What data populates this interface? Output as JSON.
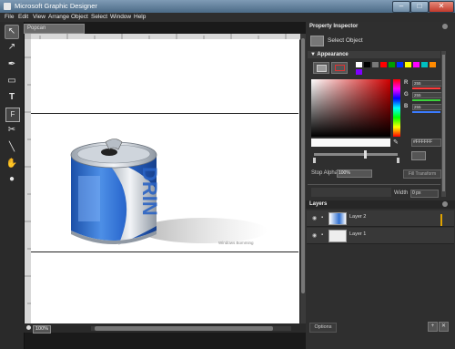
{
  "window": {
    "title": "Microsoft Graphic Designer",
    "minimize_glyph": "–",
    "maximize_glyph": "□",
    "close_glyph": "✕"
  },
  "menu": [
    "File",
    "Edit",
    "View",
    "Arrange",
    "Object",
    "Select",
    "Window",
    "Help"
  ],
  "tools": [
    {
      "name": "select-tool-icon",
      "glyph": "↖",
      "active": true
    },
    {
      "name": "direct-select-tool-icon",
      "glyph": "↗"
    },
    {
      "name": "pen-tool-icon",
      "glyph": "✒"
    },
    {
      "name": "rectangle-tool-icon",
      "glyph": "▭"
    },
    {
      "name": "text-tool-icon",
      "glyph": "T"
    },
    {
      "name": "text-frame-tool-icon",
      "glyph": "F"
    },
    {
      "name": "knife-tool-icon",
      "glyph": "✂"
    },
    {
      "name": "line-tool-icon",
      "glyph": "╲"
    },
    {
      "name": "hand-tool-icon",
      "glyph": "✋"
    },
    {
      "name": "fill-circle-icon",
      "glyph": "●"
    }
  ],
  "document": {
    "tab_label": "Popcan",
    "zoom": "100%",
    "credit_text": "Windows Bomming"
  },
  "property_inspector": {
    "title": "Property Inspector",
    "selection_label": "Select Object",
    "appearance_label": "Appearance",
    "swatches": [
      "#ffffff",
      "#000000",
      "#7a7a7a",
      "#ff0000",
      "#00a000",
      "#0030ff",
      "#ffff00",
      "#ff00ff",
      "#00c0c0",
      "#ff8a00",
      "#7f00ff"
    ],
    "channels": [
      {
        "label": "R",
        "value": "255",
        "color": "#ff3b3b"
      },
      {
        "label": "G",
        "value": "255",
        "color": "#3bd23b"
      },
      {
        "label": "B",
        "value": "255",
        "color": "#3b7bff"
      }
    ],
    "hex_value": "#FFFFFF",
    "stop_alpha_label": "Stop Alpha",
    "stop_alpha_value": "100%",
    "fill_transform_label": "Fill Transform",
    "width_label": "Width",
    "width_value": "0 px"
  },
  "layers": {
    "title": "Layers",
    "items": [
      {
        "name": "Layer 2"
      },
      {
        "name": "Layer 1"
      }
    ]
  },
  "footer": {
    "options_label": "Options",
    "add_glyph": "+",
    "delete_glyph": "✕"
  },
  "colors": {
    "can_blue": "#2f6fd0",
    "accent_orange": "#e0a300"
  }
}
